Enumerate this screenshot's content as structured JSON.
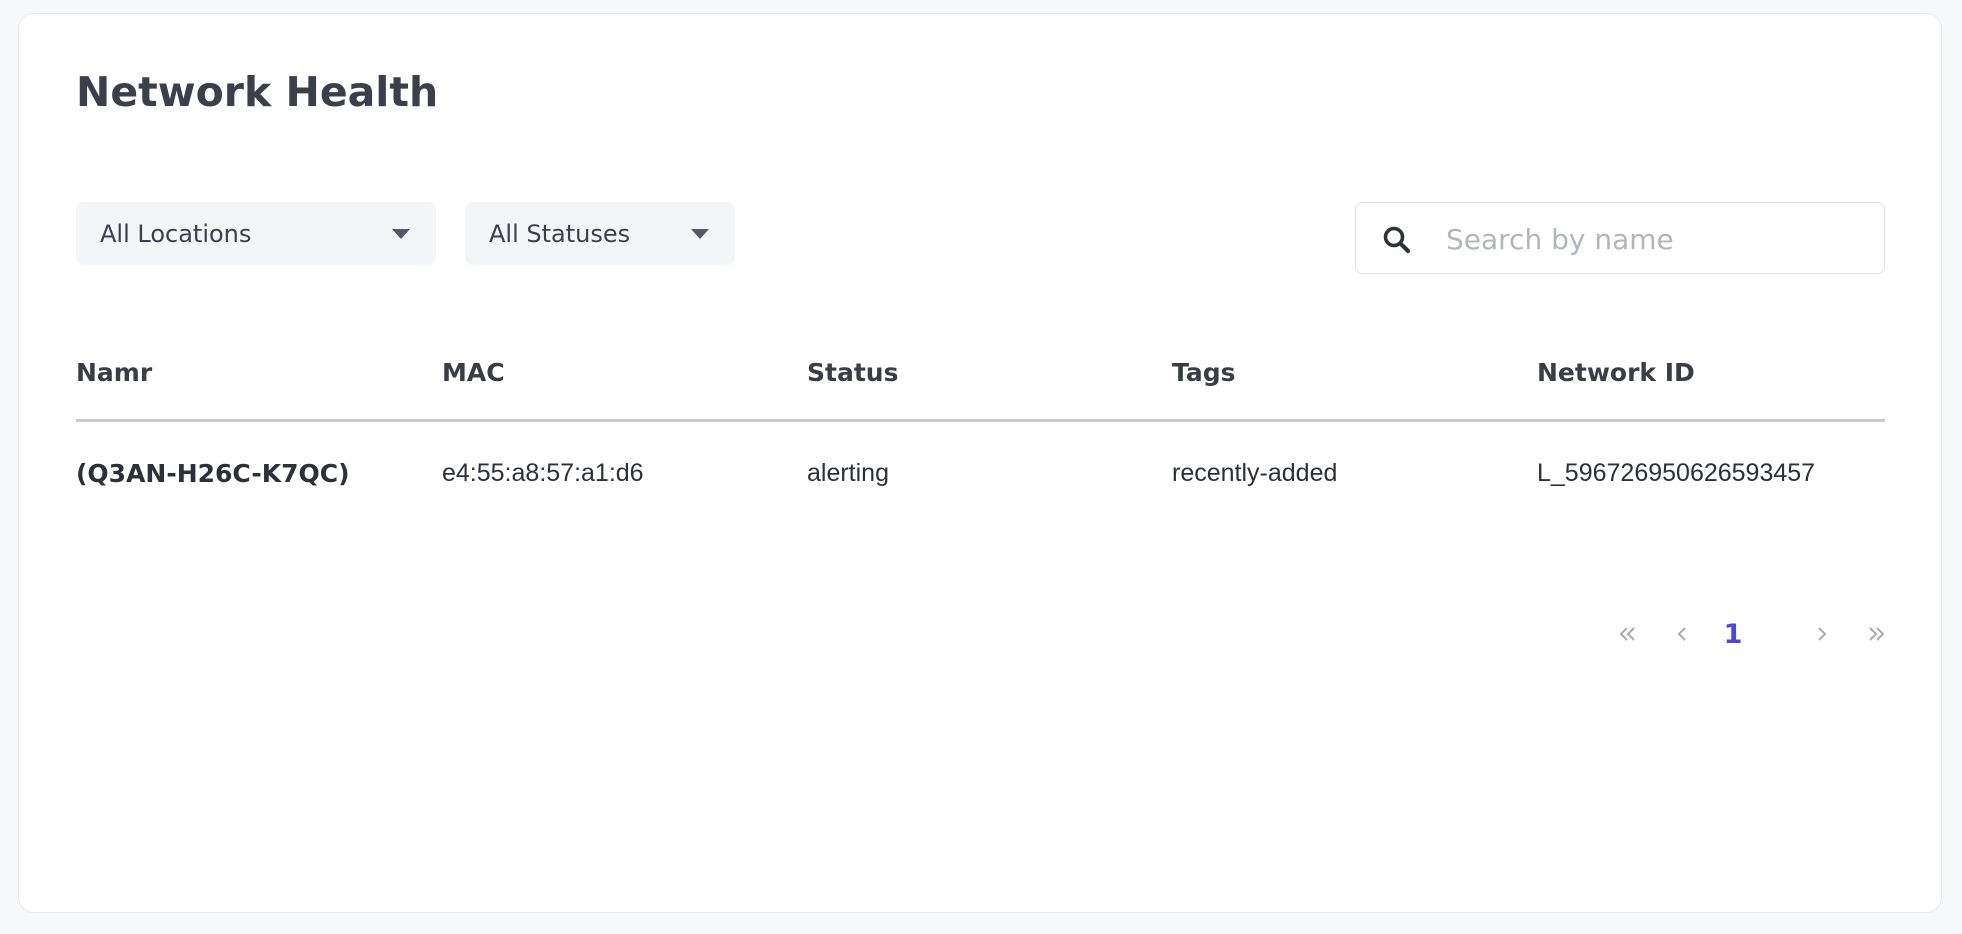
{
  "page": {
    "title": "Network Health"
  },
  "filters": {
    "location": {
      "selected": "All Locations"
    },
    "status": {
      "selected": "All Statuses"
    }
  },
  "search": {
    "placeholder": "Search by name",
    "value": ""
  },
  "table": {
    "columns": [
      "Namr",
      "MAC",
      "Status",
      "Tags",
      "Network ID"
    ],
    "rows": [
      {
        "name": "(Q3AN-H26C-K7QC)",
        "mac": "e4:55:a8:57:a1:d6",
        "status": "alerting",
        "tags": "recently-added",
        "network_id": "L_596726950626593457"
      }
    ]
  },
  "pagination": {
    "current_page": "1",
    "icons": {
      "first": "double-chevron-left-icon",
      "prev": "chevron-left-icon",
      "next": "chevron-right-icon",
      "last": "double-chevron-right-icon"
    }
  },
  "colors": {
    "accent": "#5146d6",
    "title": "#3c3f4a",
    "header_rule": "#c9cacf",
    "select_bg": "#f4f5f7"
  }
}
